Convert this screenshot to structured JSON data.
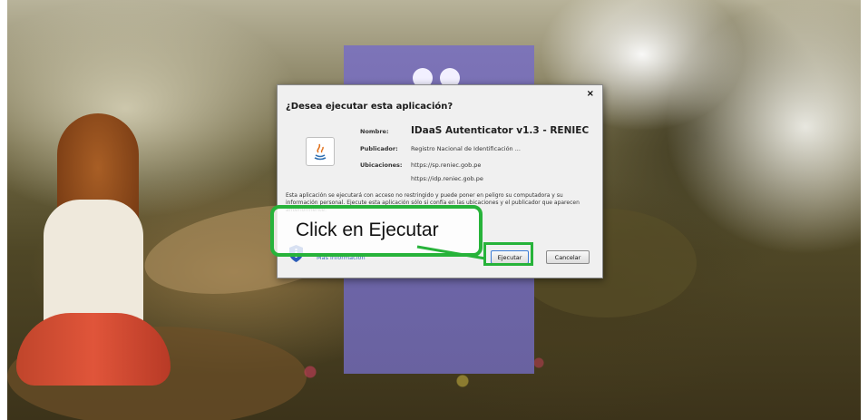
{
  "dialog": {
    "title": "¿Desea ejecutar esta aplicación?",
    "close": "×",
    "fields": {
      "name_label": "Nombre:",
      "name_value": "IDaaS Autenticator v1.3 - RENIEC",
      "publisher_label": "Publicador:",
      "publisher_value": "Registro Nacional de Identificación ...",
      "locations_label": "Ubicaciones:",
      "location_1": "https://sp.reniec.gob.pe",
      "location_2": "https://idp.reniec.gob.pe"
    },
    "warning_text": "Esta aplicación se ejecutará con acceso no restringido y puede poner en peligro su computadora y su información personal. Ejecute esta aplicación sólo si confía en las ubicaciones y el publicador que aparecen anteriormente.",
    "more_info": "Más información",
    "run_button": "Ejecutar",
    "cancel_button": "Cancelar",
    "icon": "java-icon"
  },
  "annotation": {
    "text": "Click en Ejecutar",
    "color": "#27b33a"
  }
}
